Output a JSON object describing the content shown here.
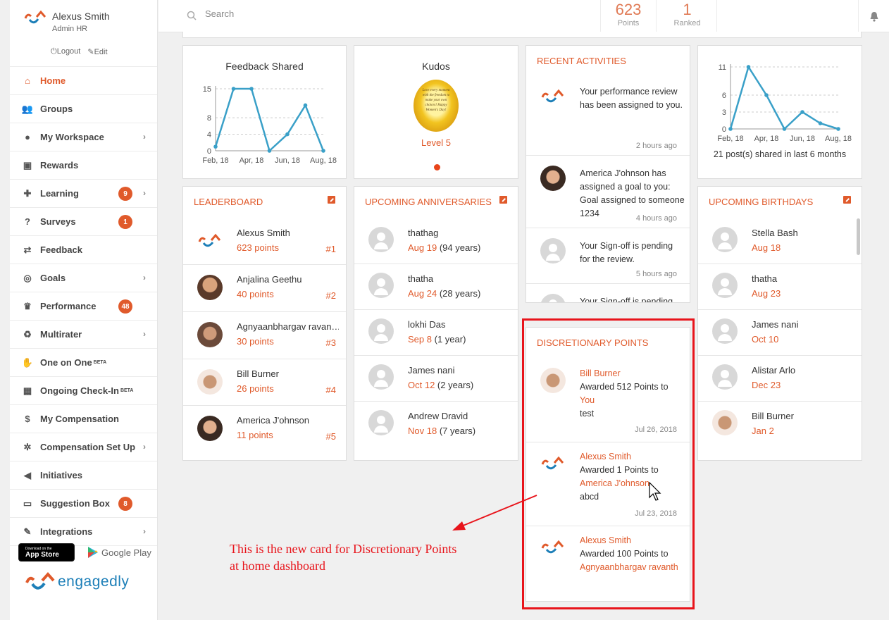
{
  "profile": {
    "name": "Alexus Smith",
    "role": "Admin HR",
    "logout": "Logout",
    "edit": "Edit"
  },
  "sidebar": {
    "items": [
      {
        "label": "Home",
        "icon": "home-icon",
        "active": true
      },
      {
        "label": "Groups",
        "icon": "groups-icon"
      },
      {
        "label": "My Workspace",
        "icon": "user-icon",
        "chevron": true
      },
      {
        "label": "Rewards",
        "icon": "gift-icon"
      },
      {
        "label": "Learning",
        "icon": "puzzle-icon",
        "badge": "9",
        "chevron": true
      },
      {
        "label": "Surveys",
        "icon": "question-icon",
        "badge": "1"
      },
      {
        "label": "Feedback",
        "icon": "exchange-icon"
      },
      {
        "label": "Goals",
        "icon": "target-icon",
        "chevron": true
      },
      {
        "label": "Performance",
        "icon": "trophy-icon",
        "badge": "48"
      },
      {
        "label": "Multirater",
        "icon": "recycle-icon",
        "chevron": true
      },
      {
        "label": "One on One",
        "icon": "handshake-icon",
        "sup": "BETA"
      },
      {
        "label": "Ongoing Check-In",
        "icon": "calendar-icon",
        "sup": "BETA"
      },
      {
        "label": "My Compensation",
        "icon": "money-icon"
      },
      {
        "label": "Compensation Set Up",
        "icon": "cogs-icon",
        "chevron": true
      },
      {
        "label": "Initiatives",
        "icon": "megaphone-icon"
      },
      {
        "label": "Suggestion Box",
        "icon": "inbox-icon",
        "badge": "8"
      },
      {
        "label": "Integrations",
        "icon": "plug-icon",
        "chevron": true
      }
    ],
    "appstore_small": "Download on the",
    "appstore_big": "App Store",
    "googleplay": "Google Play",
    "brand": "engagedly"
  },
  "header": {
    "search_placeholder": "Search",
    "points_value": "623",
    "points_label": "Points",
    "ranked_value": "1",
    "ranked_label": "Ranked"
  },
  "feedback_card": {
    "title": "Feedback Shared",
    "chart_data": {
      "type": "line",
      "x": [
        "Feb, 18",
        "Mar, 18",
        "Apr, 18",
        "May, 18",
        "Jun, 18",
        "Jul, 18",
        "Aug, 18"
      ],
      "values": [
        1,
        15,
        15,
        0,
        4,
        11,
        0
      ],
      "yticks": [
        "15",
        "8",
        "4",
        "0"
      ],
      "xticks": [
        "Feb, 18",
        "Apr, 18",
        "Jun, 18",
        "Aug, 18"
      ],
      "ylim": [
        0,
        15
      ],
      "color": "#3aa0c8"
    }
  },
  "kudos_card": {
    "title": "Kudos",
    "level": "Level 5",
    "badge_text": "Love every moment with the freedom to make your own choices! Happy Women's Day!"
  },
  "posts_card": {
    "caption": "21 post(s) shared in last 6 months",
    "chart_data": {
      "type": "line",
      "x": [
        "Feb, 18",
        "Mar, 18",
        "Apr, 18",
        "May, 18",
        "Jun, 18",
        "Jul, 18",
        "Aug, 18"
      ],
      "values": [
        0,
        11,
        6,
        0,
        3,
        1,
        0
      ],
      "yticks": [
        "11",
        "6",
        "3",
        "0"
      ],
      "xticks": [
        "Feb, 18",
        "Apr, 18",
        "Jun, 18",
        "Aug, 18"
      ],
      "ylim": [
        0,
        11
      ],
      "color": "#3aa0c8"
    }
  },
  "activities": {
    "title": "RECENT ACTIVITIES",
    "items": [
      {
        "text": "Your performance review has been assigned to you.",
        "time": "2 hours ago",
        "avatar": "logo"
      },
      {
        "text": "America J'ohnson has assigned a goal to you: Goal assigned to someone 1234",
        "time": "4 hours ago",
        "avatar": "photo"
      },
      {
        "text": "Your Sign-off is pending for the review.",
        "time": "5 hours ago",
        "avatar": "gray"
      },
      {
        "text": "Your Sign-off is pending",
        "time": "",
        "avatar": "gray"
      }
    ]
  },
  "leaderboard": {
    "title": "LEADERBOARD",
    "rows": [
      {
        "name": "Alexus Smith",
        "points": "623 points",
        "rank": "#1"
      },
      {
        "name": "Anjalina Geethu",
        "points": "40 points",
        "rank": "#2"
      },
      {
        "name": "Agnyaanbhargav ravan…",
        "points": "30 points",
        "rank": "#3"
      },
      {
        "name": "Bill Burner",
        "points": "26 points",
        "rank": "#4"
      },
      {
        "name": "America J'ohnson",
        "points": "11 points",
        "rank": "#5"
      }
    ]
  },
  "anniversaries": {
    "title": "UPCOMING ANNIVERSARIES",
    "rows": [
      {
        "name": "thathag",
        "date": "Aug 19",
        "years": "(94 years)"
      },
      {
        "name": "thatha",
        "date": "Aug 24",
        "years": "(28 years)"
      },
      {
        "name": "lokhi Das",
        "date": "Sep 8",
        "years": "(1 year)"
      },
      {
        "name": "James nani",
        "date": "Oct 12",
        "years": "(2 years)"
      },
      {
        "name": "Andrew Dravid",
        "date": "Nov 18",
        "years": "(7 years)"
      }
    ]
  },
  "birthdays": {
    "title": "UPCOMING BIRTHDAYS",
    "rows": [
      {
        "name": "Stella Bash",
        "date": "Aug 18"
      },
      {
        "name": "thatha",
        "date": "Aug 23"
      },
      {
        "name": "James nani",
        "date": "Oct 10"
      },
      {
        "name": "Alistar Arlo",
        "date": "Dec 23"
      },
      {
        "name": "Bill Burner",
        "date": "Jan 2"
      }
    ]
  },
  "discretionary": {
    "title": "DISCRETIONARY POINTS",
    "items": [
      {
        "giver": "Bill Burner",
        "awarded": "Awarded 512 Points to",
        "receiver": "You",
        "note": "test",
        "date": "Jul 26, 2018"
      },
      {
        "giver": "Alexus Smith",
        "awarded": "Awarded 1 Points to",
        "receiver": "America J'ohnson",
        "note": "abcd",
        "date": "Jul 23, 2018"
      },
      {
        "giver": "Alexus Smith",
        "awarded": "Awarded 100 Points to",
        "receiver": "Agnyaanbhargav ravanth",
        "note": "",
        "date": ""
      }
    ]
  },
  "annotation": {
    "line1": "This is the new card for Discretionary Points",
    "line2": "at home dashboard"
  },
  "colors": {
    "accent": "#e05a2b",
    "chart": "#3aa0c8",
    "annotation": "#e8141b"
  }
}
